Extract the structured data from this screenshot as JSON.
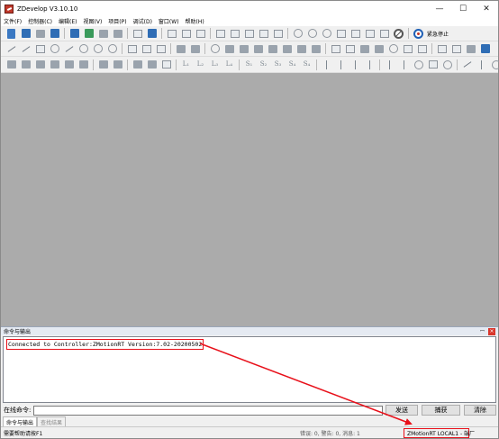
{
  "window": {
    "title": "ZDevelop V3.10.10",
    "controls": {
      "minimize": "—",
      "maximize": "☐",
      "close": "✕"
    }
  },
  "menu": [
    "文件(F)",
    "控制器(C)",
    "编辑(E)",
    "视图(V)",
    "项目(P)",
    "调试(D)",
    "窗口(W)",
    "帮助(H)"
  ],
  "toolbar": {
    "emergency_stop_label": "紧急停止",
    "text_icons": {
      "l1": "L₁",
      "l2": "L₂",
      "l3": "L₃",
      "l4": "L₄",
      "s1": "S₁",
      "s2": "S₂",
      "s3": "S₃",
      "s4": "S₄"
    }
  },
  "output_panel": {
    "title": "命令与输出",
    "pin": "ꟷ",
    "close": "×",
    "lines": [
      "Connected to Controller:ZMotionRT Version:7.02-20200502"
    ]
  },
  "command_row": {
    "label": "在线命令:",
    "input_value": "",
    "send_button": "发送",
    "capture_button": "捕获",
    "clear_button": "清除"
  },
  "bottom_tabs": [
    "命令与输出",
    "查找结果"
  ],
  "status_bar": {
    "help_text": "需要帮助请按F1",
    "counts": "错误: 0, 警告: 0, 消息: 1",
    "connection": "ZMotionRT LOCAL1 - 端厂"
  },
  "colors": {
    "workspace": "#ababab",
    "highlight": "#e8101a"
  }
}
